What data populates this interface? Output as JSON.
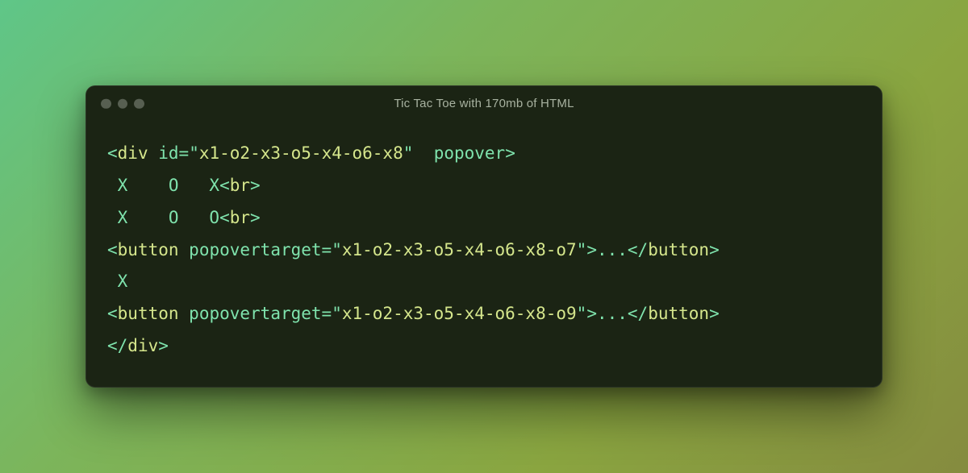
{
  "window": {
    "title": "Tic Tac Toe with 170mb of HTML"
  },
  "code": {
    "l1": {
      "tag_open": "<",
      "tag": "div",
      "sp1": " ",
      "attr1": "id",
      "eq": "=",
      "q1": "\"",
      "val1": "x1-o2-x3-o5-x4-o6-x8",
      "q2": "\"",
      "sp2": "  ",
      "attr2": "popover",
      "close": ">"
    },
    "l2": {
      "txt": " X    O   X",
      "br_open": "<",
      "br_tag": "br",
      "br_close": ">"
    },
    "l3": {
      "txt": " X    O   O",
      "br_open": "<",
      "br_tag": "br",
      "br_close": ">"
    },
    "l4": {
      "open": "<",
      "tag": "button",
      "sp": " ",
      "attr": "popovertarget",
      "eq": "=",
      "q1": "\"",
      "val": "x1-o2-x3-o5-x4-o6-x8-o7",
      "q2": "\"",
      "close": ">",
      "content": "...",
      "end_open": "</",
      "end_tag": "button",
      "end_close": ">"
    },
    "l5": {
      "txt": " X"
    },
    "l6": {
      "open": "<",
      "tag": "button",
      "sp": " ",
      "attr": "popovertarget",
      "eq": "=",
      "q1": "\"",
      "val": "x1-o2-x3-o5-x4-o6-x8-o9",
      "q2": "\"",
      "close": ">",
      "content": "...",
      "end_open": "</",
      "end_tag": "button",
      "end_close": ">"
    },
    "l7": {
      "open": "</",
      "tag": "div",
      "close": ">"
    }
  }
}
